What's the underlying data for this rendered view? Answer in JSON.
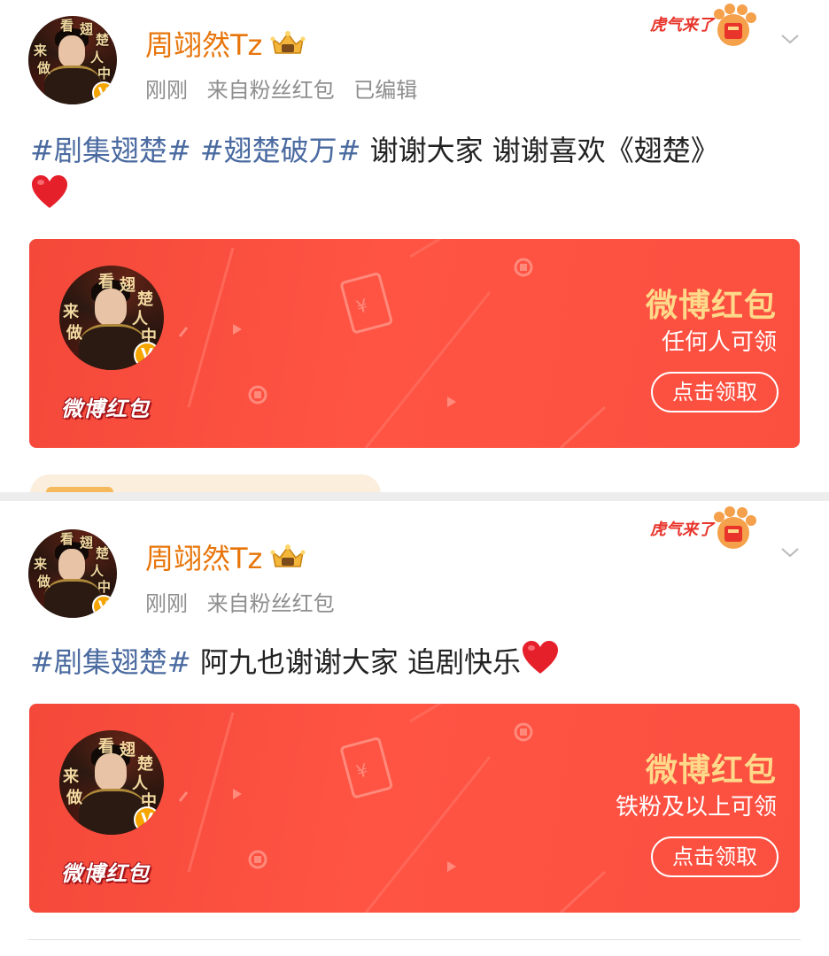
{
  "posts": [
    {
      "avatar_chars": [
        "来",
        "看",
        "翅",
        "楚",
        "做",
        "人",
        "中"
      ],
      "username": "周翊然Tz",
      "meta": [
        "刚刚",
        "来自粉丝红包",
        "已编辑"
      ],
      "content": {
        "topics": [
          "#剧集翅楚#",
          "#翅楚破万#"
        ],
        "text": "谢谢大家 谢谢喜欢《翅楚》"
      },
      "redpacket": {
        "logo": "微博红包",
        "title": "微博红包",
        "subtitle": "任何人可领",
        "button": "点击领取"
      }
    },
    {
      "avatar_chars": [
        "来",
        "看",
        "翅",
        "楚",
        "做",
        "人",
        "中"
      ],
      "username": "周翊然Tz",
      "meta": [
        "刚刚",
        "来自粉丝红包"
      ],
      "content": {
        "topics": [
          "#剧集翅楚#"
        ],
        "text": "阿九也谢谢大家 追剧快乐"
      },
      "redpacket": {
        "logo": "微博红包",
        "title": "微博红包",
        "subtitle": "铁粉及以上可领",
        "button": "点击领取"
      }
    }
  ],
  "verified_badge": "V",
  "tiger_text": "虎气来了",
  "colors": {
    "username": "#e8750a",
    "topic": "#4a6aa0",
    "meta": "#8e8e8e",
    "card_red": "#ff5444",
    "card_title": "#ffd98a"
  },
  "icons": [
    "chevron-down-icon",
    "heart-emoji-icon",
    "crown-badge-icon",
    "tiger-paw-icon",
    "verified-badge-icon"
  ]
}
